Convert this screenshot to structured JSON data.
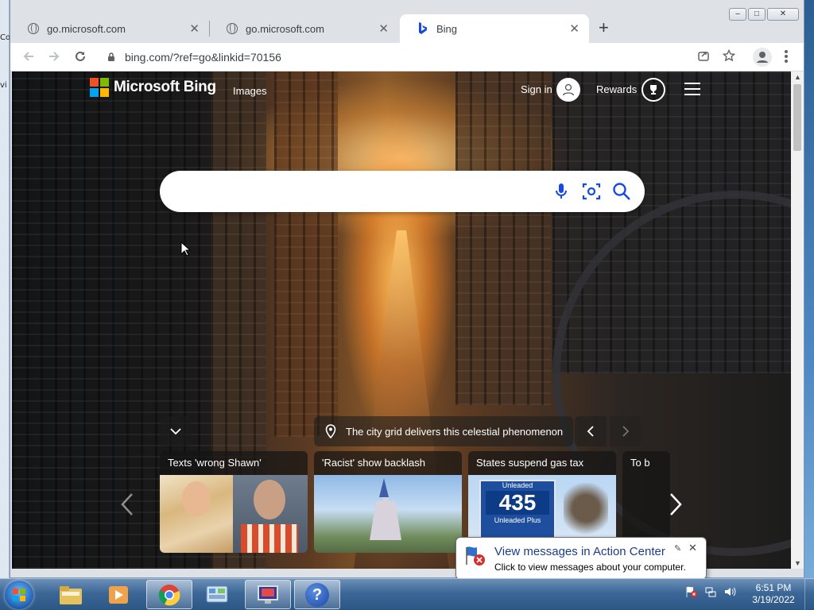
{
  "left_window": {
    "fragment_1": "Co",
    "fragment_2": "vi"
  },
  "browser": {
    "tabs": [
      {
        "title": "go.microsoft.com",
        "close": "✕"
      },
      {
        "title": "go.microsoft.com",
        "close": "✕"
      },
      {
        "title": "Bing",
        "close": "✕"
      }
    ],
    "new_tab": "+",
    "window_controls": {
      "minimize": "–",
      "maximize": "□",
      "close": "✕"
    },
    "url": "bing.com/?ref=go&linkid=70156"
  },
  "bing": {
    "brand": "Microsoft Bing",
    "nav_images": "Images",
    "sign_in": "Sign in",
    "rewards": "Rewards",
    "search_value": "",
    "caption": "The city grid delivers this celestial phenomenon",
    "cards": [
      {
        "title": "Texts 'wrong Shawn'"
      },
      {
        "title": "'Racist' show backlash"
      },
      {
        "title": "States suspend gas tax"
      },
      {
        "title": "To b"
      }
    ],
    "gas_sign": {
      "label1": "Unleaded",
      "price": "435",
      "label2": "Unleaded Plus"
    }
  },
  "balloon": {
    "heading": "View messages in Action Center",
    "text": "Click to view messages about your computer."
  },
  "taskbar": {
    "time": "6:51 PM",
    "date": "3/19/2022",
    "help_label": "?"
  },
  "colors": {
    "ms_red": "#f25022",
    "ms_green": "#7fba00",
    "ms_blue": "#00a4ef",
    "ms_yellow": "#ffb900",
    "bing_blue": "#174ae4",
    "balloon_heading": "#1a3e8c"
  }
}
